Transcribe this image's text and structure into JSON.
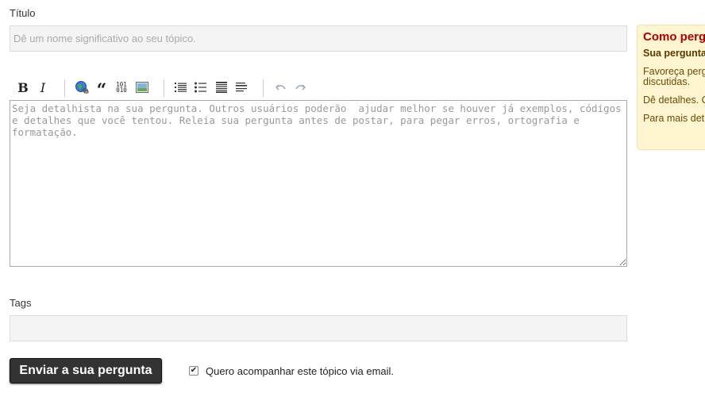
{
  "form": {
    "title_label": "Título",
    "title_placeholder": "Dê um nome significativo ao seu tópico.",
    "title_value": "",
    "body_placeholder": "Seja detalhista na sua pergunta. Outros usuários poderão  ajudar melhor se houver já exemplos, códigos e detalhes que você tentou. Releia sua pergunta antes de postar, para pegar erros, ortografia e formatação.",
    "body_value": "",
    "tags_label": "Tags",
    "tags_value": "",
    "submit_label": "Enviar a sua pergunta",
    "follow_label": "Quero acompanhar este tópico via email.",
    "follow_checked": true
  },
  "toolbar": {
    "bold": "B",
    "italic": "I",
    "quote": "“",
    "code_top": "101",
    "code_bottom": "010",
    "icons": [
      "bold-icon",
      "italic-icon",
      "link-icon",
      "quote-icon",
      "code-icon",
      "image-icon",
      "ordered-list-icon",
      "unordered-list-icon",
      "heading-icon",
      "horizontal-rule-icon",
      "undo-icon",
      "redo-icon"
    ]
  },
  "sidebar": {
    "title": "Como perg",
    "subtitle": "Sua pergunta",
    "paragraphs": [
      "Favoreça perg discutidas.",
      "Dê detalhes. C",
      "Para mais det"
    ]
  },
  "colors": {
    "accent_red": "#b20000",
    "sidebar_bg": "#fff5d1",
    "button_bg": "#333333"
  }
}
